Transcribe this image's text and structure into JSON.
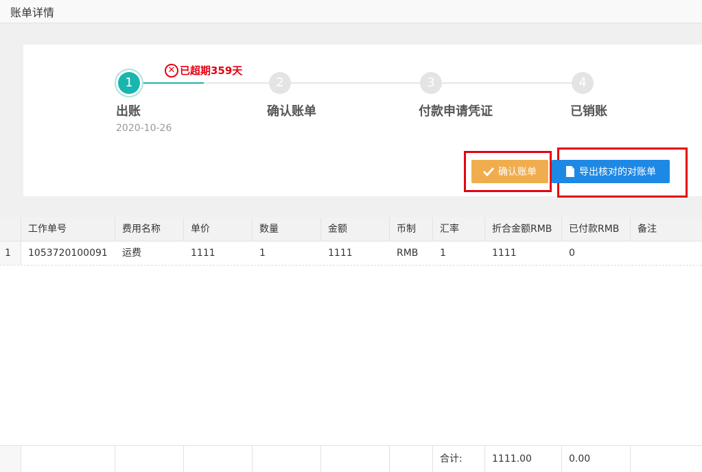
{
  "page": {
    "title": "账单详情"
  },
  "steps": [
    {
      "num": "1",
      "label": "出账",
      "date": "2020-10-26"
    },
    {
      "num": "2",
      "label": "确认账单"
    },
    {
      "num": "3",
      "label": "付款申请凭证"
    },
    {
      "num": "4",
      "label": "已销账"
    }
  ],
  "overdue": {
    "text": "已超期359天",
    "icon": "close-circle-icon"
  },
  "actions": {
    "confirm_label": "确认账单",
    "confirm_icon": "check-icon",
    "export_label": "导出核对的对账单",
    "export_icon": "file-icon"
  },
  "table": {
    "columns": [
      "工作单号",
      "费用名称",
      "单价",
      "数量",
      "金额",
      "币制",
      "汇率",
      "折合金额RMB",
      "已付款RMB",
      "备注"
    ],
    "rows": [
      {
        "index": "1",
        "cells": [
          "1053720100091",
          "运费",
          "1111",
          "1",
          "1111",
          "RMB",
          "1",
          "1111",
          "0",
          ""
        ]
      }
    ],
    "footer": {
      "label": "合计:",
      "total_rmb": "1111.00",
      "paid_rmb": "0.00"
    }
  },
  "colors": {
    "accent": "#1ab5ae",
    "warning": "#f0ad4e",
    "primary": "#1e88e5",
    "danger": "#e60012"
  }
}
